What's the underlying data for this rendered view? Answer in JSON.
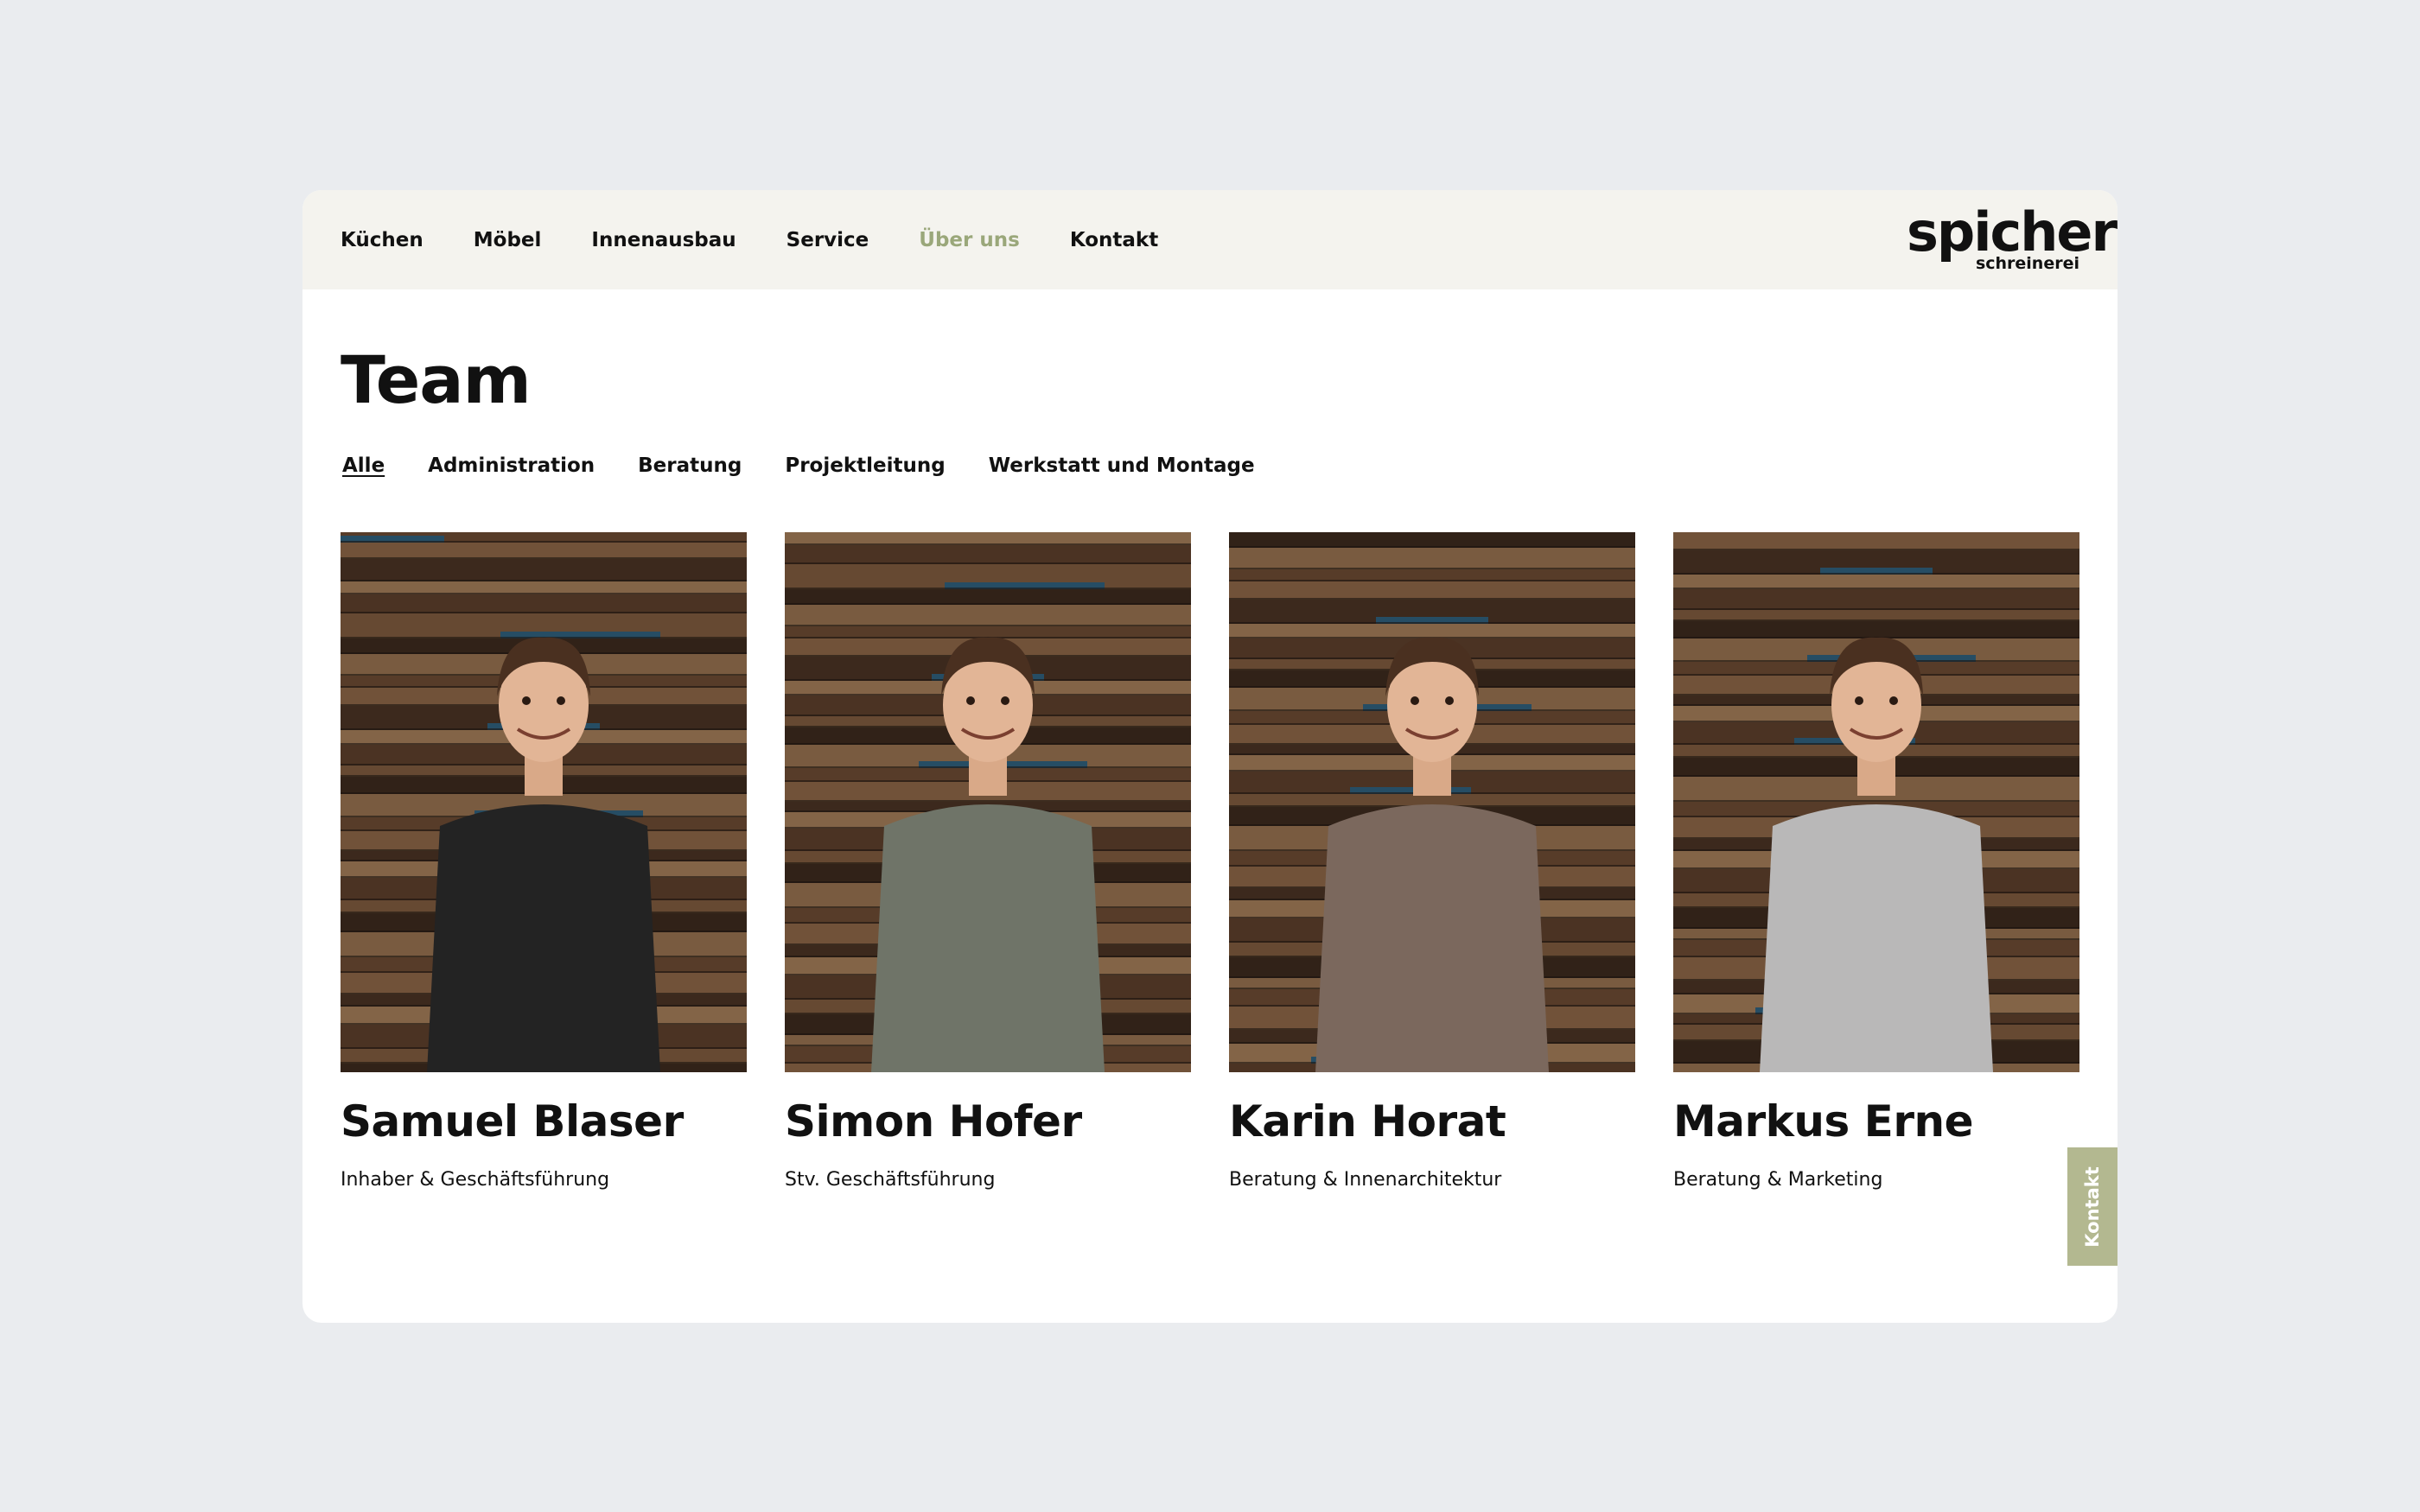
{
  "nav": {
    "items": [
      {
        "label": "Küchen",
        "active": false
      },
      {
        "label": "Möbel",
        "active": false
      },
      {
        "label": "Innenausbau",
        "active": false
      },
      {
        "label": "Service",
        "active": false
      },
      {
        "label": "Über uns",
        "active": true
      },
      {
        "label": "Kontakt",
        "active": false
      }
    ]
  },
  "logo": {
    "word": "spicher",
    "sub": "schreinerei"
  },
  "page": {
    "title": "Team"
  },
  "filters": [
    {
      "label": "Alle",
      "active": true
    },
    {
      "label": "Administration",
      "active": false
    },
    {
      "label": "Beratung",
      "active": false
    },
    {
      "label": "Projektleitung",
      "active": false
    },
    {
      "label": "Werkstatt und Montage",
      "active": false
    }
  ],
  "team": [
    {
      "name": "Samuel Blaser",
      "role": "Inhaber & Geschäftsführung",
      "shirt": "#232323"
    },
    {
      "name": "Simon Hofer",
      "role": "Stv. Geschäftsführung",
      "shirt": "#6f7468"
    },
    {
      "name": "Karin Horat",
      "role": "Beratung & Innenarchitektur",
      "shirt": "#7b685d"
    },
    {
      "name": "Markus Erne",
      "role": "Beratung & Marketing",
      "shirt": "#b9b8b8"
    }
  ],
  "side_tab": {
    "label": "Kontakt"
  },
  "colors": {
    "accent": "#9aa77a",
    "tab": "#b3b890",
    "header_bg": "#f4f3ee",
    "page_bg": "#eaecef"
  }
}
